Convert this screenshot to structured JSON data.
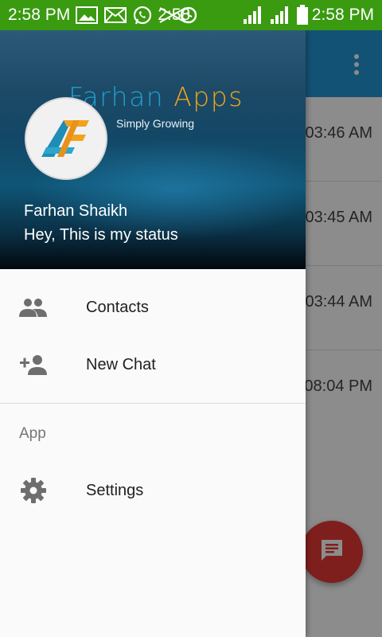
{
  "status_bar": {
    "time_left": "2:58 PM",
    "time_mid": "2:58",
    "time_right": "2:58 PM",
    "left_icons": [
      "image-icon",
      "mail-icon",
      "whatsapp-icon"
    ],
    "right_icons": [
      "signal-icon",
      "signal-icon-2",
      "battery-icon"
    ],
    "color": "#3a9a10"
  },
  "drawer": {
    "header": {
      "brand_part1": "Farhan",
      "brand_part2": "Apps",
      "tagline": "Simply Growing",
      "user_name": "Farhan Shaikh",
      "user_status": "Hey, This is my status"
    },
    "items": [
      {
        "label": "Contacts",
        "icon": "contacts-icon"
      },
      {
        "label": "New Chat",
        "icon": "add-person-icon"
      }
    ],
    "section_label": "App",
    "section_items": [
      {
        "label": "Settings",
        "icon": "gear-icon"
      }
    ]
  },
  "background": {
    "appbar_color": "#2196d6",
    "chat_times": [
      "03:46 AM",
      "03:45 AM",
      "03:44 AM",
      "08:04 PM"
    ],
    "fab_icon": "message-icon",
    "fab_color": "#e53935"
  }
}
